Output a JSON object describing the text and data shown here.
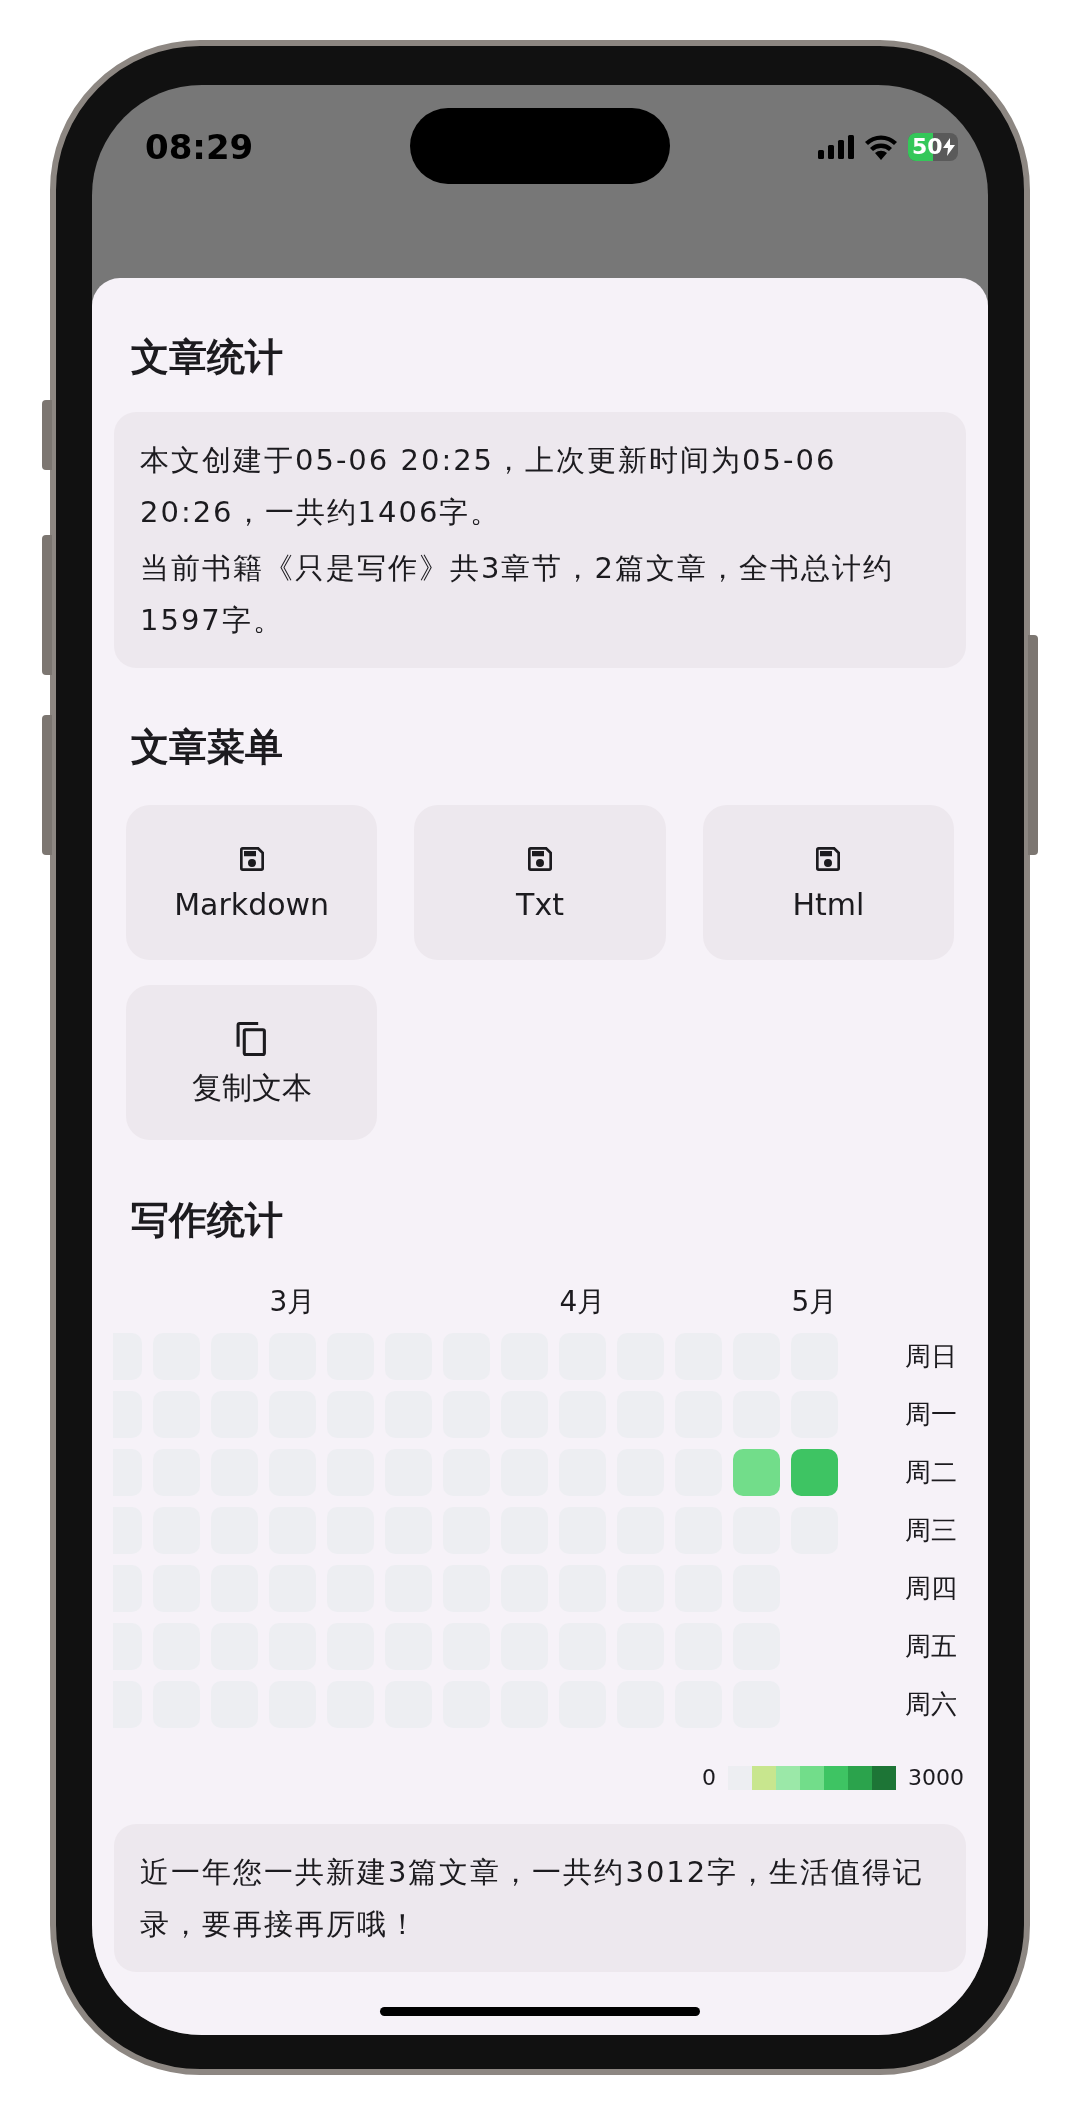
{
  "status_bar": {
    "time": "08:29",
    "battery": "50"
  },
  "sheet": {
    "stats_heading": "文章统计",
    "stats_paragraphs": [
      "本文创建于05-06 20:25，上次更新时间为05-06 20:26，一共约1406字。",
      "当前书籍《只是写作》共3章节，2篇文章，全书总计约1597字。"
    ],
    "menu_heading": "文章菜单",
    "menu_items": [
      {
        "kind": "save",
        "label": "Markdown"
      },
      {
        "kind": "save",
        "label": "Txt"
      },
      {
        "kind": "save",
        "label": "Html"
      },
      {
        "kind": "copy",
        "label": "复制文本"
      }
    ],
    "writing_heading": "写作统计",
    "heatmap": {
      "weekdays": [
        "周日",
        "周一",
        "周二",
        "周三",
        "周四",
        "周五",
        "周六"
      ],
      "weeks": [
        {
          "days": [
            {
              "color": "#edeef2"
            },
            {
              "color": "#edeef2"
            },
            {
              "color": "#edeef2"
            },
            {
              "color": "#edeef2"
            },
            {
              "color": "#edeef2"
            },
            {
              "color": "#edeef2"
            },
            {
              "color": "#edeef2"
            }
          ]
        },
        {
          "days": [
            {
              "color": "#edeef2"
            },
            {
              "color": "#edeef2"
            },
            {
              "color": "#edeef2"
            },
            {
              "color": "#edeef2"
            },
            {
              "color": "#edeef2"
            },
            {
              "color": "#edeef2"
            },
            {
              "color": "#edeef2"
            }
          ]
        },
        {
          "days": [
            {
              "color": "#edeef2"
            },
            {
              "color": "#edeef2"
            },
            {
              "color": "#edeef2"
            },
            {
              "color": "#edeef2"
            },
            {
              "color": "#edeef2"
            },
            {
              "color": "#edeef2"
            },
            {
              "color": "#edeef2"
            }
          ]
        },
        {
          "month": "3月",
          "days": [
            {
              "color": "#edeef2"
            },
            {
              "color": "#edeef2"
            },
            {
              "color": "#edeef2"
            },
            {
              "color": "#edeef2"
            },
            {
              "color": "#edeef2"
            },
            {
              "color": "#edeef2"
            },
            {
              "color": "#edeef2"
            }
          ]
        },
        {
          "days": [
            {
              "color": "#edeef2"
            },
            {
              "color": "#edeef2"
            },
            {
              "color": "#edeef2"
            },
            {
              "color": "#edeef2"
            },
            {
              "color": "#edeef2"
            },
            {
              "color": "#edeef2"
            },
            {
              "color": "#edeef2"
            }
          ]
        },
        {
          "days": [
            {
              "color": "#edeef2"
            },
            {
              "color": "#edeef2"
            },
            {
              "color": "#edeef2"
            },
            {
              "color": "#edeef2"
            },
            {
              "color": "#edeef2"
            },
            {
              "color": "#edeef2"
            },
            {
              "color": "#edeef2"
            }
          ]
        },
        {
          "days": [
            {
              "color": "#edeef2"
            },
            {
              "color": "#edeef2"
            },
            {
              "color": "#edeef2"
            },
            {
              "color": "#edeef2"
            },
            {
              "color": "#edeef2"
            },
            {
              "color": "#edeef2"
            },
            {
              "color": "#edeef2"
            }
          ]
        },
        {
          "days": [
            {
              "color": "#edeef2"
            },
            {
              "color": "#edeef2"
            },
            {
              "color": "#edeef2"
            },
            {
              "color": "#edeef2"
            },
            {
              "color": "#edeef2"
            },
            {
              "color": "#edeef2"
            },
            {
              "color": "#edeef2"
            }
          ]
        },
        {
          "month": "4月",
          "days": [
            {
              "color": "#edeef2"
            },
            {
              "color": "#edeef2"
            },
            {
              "color": "#edeef2"
            },
            {
              "color": "#edeef2"
            },
            {
              "color": "#edeef2"
            },
            {
              "color": "#edeef2"
            },
            {
              "color": "#edeef2"
            }
          ]
        },
        {
          "days": [
            {
              "color": "#edeef2"
            },
            {
              "color": "#edeef2"
            },
            {
              "color": "#edeef2"
            },
            {
              "color": "#edeef2"
            },
            {
              "color": "#edeef2"
            },
            {
              "color": "#edeef2"
            },
            {
              "color": "#edeef2"
            }
          ]
        },
        {
          "days": [
            {
              "color": "#edeef2"
            },
            {
              "color": "#edeef2"
            },
            {
              "color": "#edeef2"
            },
            {
              "color": "#edeef2"
            },
            {
              "color": "#edeef2"
            },
            {
              "color": "#edeef2"
            },
            {
              "color": "#edeef2"
            }
          ]
        },
        {
          "days": [
            {
              "color": "#edeef2"
            },
            {
              "color": "#edeef2"
            },
            {
              "color": "#72dd8a"
            },
            {
              "color": "#edeef2"
            },
            {
              "color": "#edeef2"
            },
            {
              "color": "#edeef2"
            },
            {
              "color": "#edeef2"
            }
          ]
        },
        {
          "month": "5月",
          "days": [
            {
              "color": "#edeef2"
            },
            {
              "color": "#edeef2"
            },
            {
              "color": "#3ec463"
            },
            {
              "color": "#edeef2"
            }
          ]
        }
      ],
      "legend": {
        "min": "0",
        "max": "3000",
        "swatches": [
          {
            "color": "#edeef2"
          },
          {
            "color": "#c8e68e"
          },
          {
            "color": "#9be8a8"
          },
          {
            "color": "#72dd8a"
          },
          {
            "color": "#3ec463"
          },
          {
            "color": "#2ba34c"
          },
          {
            "color": "#1d7536"
          }
        ]
      }
    },
    "summary": "近一年您一共新建3篇文章，一共约3012字，生活值得记录，要再接再厉哦！"
  }
}
